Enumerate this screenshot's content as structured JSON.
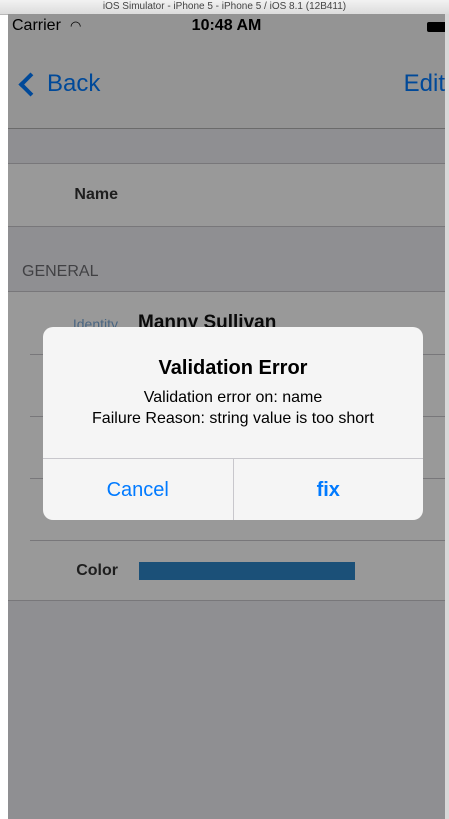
{
  "simulator": {
    "title": "iOS Simulator - iPhone 5 - iPhone 5 / iOS 8.1 (12B411)"
  },
  "status_bar": {
    "carrier": "Carrier",
    "wifi_icon": "wifi-icon",
    "time": "10:48 AM",
    "battery_icon": "battery-icon"
  },
  "nav": {
    "back_label": "Back",
    "edit_label": "Edit"
  },
  "form": {
    "name_label": "Name",
    "section_header": "GENERAL",
    "identity_label": "Identity",
    "identity_value": "Manny Sullivan",
    "color_label": "Color",
    "color_value": "#2e86c9"
  },
  "alert": {
    "title": "Validation Error",
    "message_line1": "Validation error on: name",
    "message_line2": "Failure Reason: string value is too short",
    "cancel_label": "Cancel",
    "fix_label": "fix"
  },
  "colors": {
    "accent": "#007aff",
    "color_bar": "#2e86c9",
    "overlay": "rgba(0,0,0,0.4)"
  }
}
